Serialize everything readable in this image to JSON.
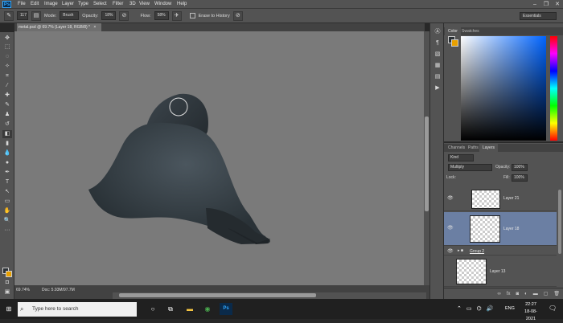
{
  "app": {
    "logo": "Ps"
  },
  "menu": [
    "File",
    "Edit",
    "Image",
    "Layer",
    "Type",
    "Select",
    "Filter",
    "3D",
    "View",
    "Window",
    "Help"
  ],
  "window_controls": [
    "–",
    "❐",
    "✕"
  ],
  "options": {
    "brush_size": "117",
    "mode_label": "Mode:",
    "mode_value": "Brush",
    "opacity_label": "Opacity:",
    "opacity_value": "18%",
    "flow_label": "Flow:",
    "flow_value": "58%",
    "erase_history_label": "Erase to History",
    "workspace": "Essentials"
  },
  "document": {
    "tab_title": "metal.psd @ 69.7% (Layer 18, RGB/8) *",
    "close": "×",
    "zoom": "69.74%",
    "doc_size": "Doc: 5.93M/97.7M"
  },
  "color_panel": {
    "tabs": [
      "Color",
      "Swatches"
    ],
    "fg": "#2b3136",
    "bg": "#e8a000"
  },
  "layers_panel": {
    "tabs": [
      "Channels",
      "Paths",
      "Layers"
    ],
    "kind": "Kind",
    "blend_mode": "Multiply",
    "opacity_label": "Opacity:",
    "opacity_value": "100%",
    "lock_label": "Lock:",
    "fill_label": "Fill:",
    "fill_value": "100%",
    "layers": [
      {
        "name": "Layer 21",
        "selected": false
      },
      {
        "name": "Layer 18",
        "selected": true
      },
      {
        "name": "Group 2",
        "group": true
      },
      {
        "name": "Layer 13",
        "selected": false
      }
    ]
  },
  "taskbar": {
    "search_placeholder": "Type here to search",
    "language": "ENG",
    "time": "22:27",
    "date": "18-08-2021"
  },
  "colors": {
    "accent": "#31a8ff",
    "panel": "#535353",
    "canvas": "#7a7a7a",
    "selected_layer": "#6b7fa3",
    "metal_dark": "#2b3136"
  }
}
